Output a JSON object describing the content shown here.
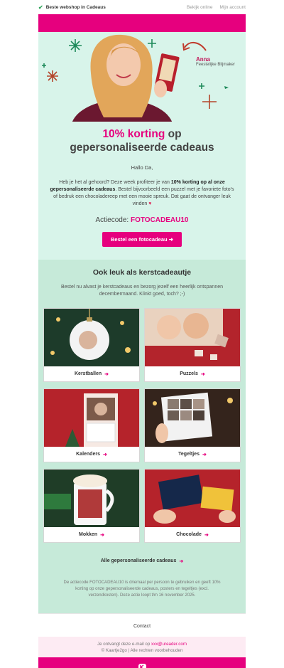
{
  "topbar": {
    "tagline": "Beste webshop in Cadeaus",
    "view_online": "Bekijk online",
    "account": "Mijn account"
  },
  "hero": {
    "name": "Anna",
    "role": "Feestelijke Blijmaker"
  },
  "intro": {
    "headline_pink": "10% korting",
    "headline_rest1": " op",
    "headline_rest2": "gepersonaliseerde cadeaus",
    "greeting": "Hallo Da,",
    "body_a": "Heb je het al gehoord? Deze week profiteer je van ",
    "body_bold": "10% korting op al onze gepersonaliseerde cadeaus",
    "body_b": ". Bestel bijvoorbeeld een puzzel met je favoriete foto's of bedruk een chocoladereep met een mooie spreuk. Dat gaat de ontvanger leuk vinden ",
    "heart": "♥",
    "code_label": "Actiecode: ",
    "code": "FOTOCADEAU10",
    "cta": "Bestel een fotocadeau"
  },
  "also": {
    "title": "Ook leuk als kerstcadeautje",
    "subtitle": "Bestel nu alvast je kerstcadeaus en bezorg jezelf een heerlijk ontspannen decembermaand. Klinkt goed, toch? ;-)",
    "cards": [
      {
        "label": "Kerstballen"
      },
      {
        "label": "Puzzels"
      },
      {
        "label": "Kalenders"
      },
      {
        "label": "Tegeltjes"
      },
      {
        "label": "Mokken"
      },
      {
        "label": "Chocolade"
      }
    ],
    "all_link": "Alle gepersonaliseerde cadeaus",
    "disclaimer": "De actiecode FOTOCADEAU10 is driemaal per persoon te gebruiken en geeft 10% korting op onze gepersonaliseerde cadeaus, posters en tegeltjes (excl. verzendkosten). Deze actie loopt t/m 16 november 2025."
  },
  "footer": {
    "contact": "Contact",
    "received_prefix": "Je ontvangt deze e-mail op ",
    "email": "xxx@ureader.com",
    "copyright": "© Kaartje2go | Alle rechten voorbehouden"
  },
  "colors": {
    "brand_pink": "#e6007e",
    "mint": "#d8f4ea",
    "mint_dark": "#c6ead9"
  }
}
